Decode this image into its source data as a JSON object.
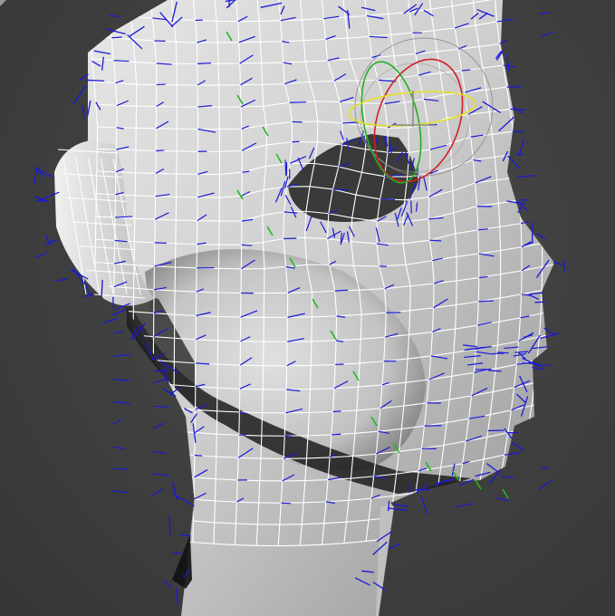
{
  "viewport": {
    "background_color": "#3e3e3e",
    "mesh": {
      "surface_color": "#c9c9c9",
      "wire_color": "#ffffff",
      "normal_color": "#1a1ad8",
      "selected_normal_color": "#1fb81f"
    },
    "gizmo": {
      "type": "rotate",
      "x_axis_color": "#d02020",
      "y_axis_color": "#20b020",
      "z_axis_color": "#e8e020",
      "trackball_color": "#9a9a9a"
    }
  }
}
